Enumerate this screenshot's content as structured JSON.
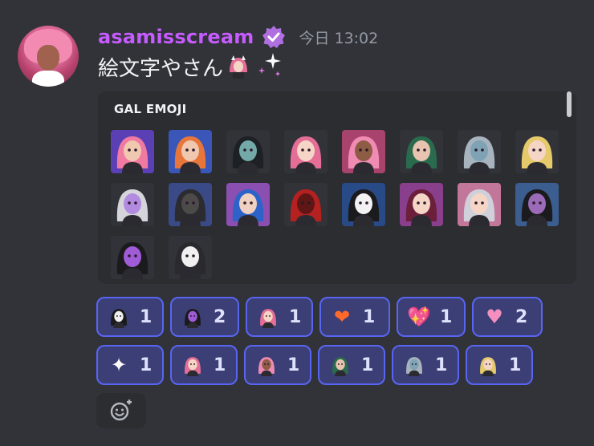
{
  "message": {
    "username": "asamisscream",
    "timestamp": "今日 13:02",
    "text": "絵文字やさん",
    "inline_emojis": [
      "gal-emoji-pink-hair",
      "sparkles-emoji"
    ]
  },
  "embed": {
    "title": "GAL EMOJI",
    "emojis": [
      {
        "name": "pink-hair-purple-bg",
        "bg": "#5b3fb5",
        "hair": "#f17aa3",
        "skin": "#f0c8b0"
      },
      {
        "name": "orange-hair",
        "bg": "#3a56b8",
        "hair": "#e8763a",
        "skin": "#f0c8b0"
      },
      {
        "name": "dark-teal-cat",
        "bg": "#313338",
        "hair": "#1d2024",
        "skin": "#73a9a6"
      },
      {
        "name": "pink-hair-bunny",
        "bg": "#313338",
        "hair": "#e46e96",
        "skin": "#f5d6c6"
      },
      {
        "name": "pink-hair-tan",
        "bg": "#a8436e",
        "hair": "#f08cb4",
        "skin": "#8e5b45"
      },
      {
        "name": "green-hair-crown",
        "bg": "#313338",
        "hair": "#2a6b4e",
        "skin": "#e8c4b0"
      },
      {
        "name": "blue-skin-silver",
        "bg": "#313338",
        "hair": "#a7b3bd",
        "skin": "#7fa2b5"
      },
      {
        "name": "blonde-long",
        "bg": "#313338",
        "hair": "#e5c96a",
        "skin": "#f5d6c6"
      },
      {
        "name": "silver-purple-mask",
        "bg": "#313338",
        "hair": "#d5d4da",
        "skin": "#b28be0"
      },
      {
        "name": "dark-hood",
        "bg": "#3a4a86",
        "hair": "#2b2b30",
        "skin": "#4d4a4a"
      },
      {
        "name": "blue-hair-mic",
        "bg": "#8a4fb0",
        "hair": "#2d62c8",
        "skin": "#f0d0c0"
      },
      {
        "name": "red-hood",
        "bg": "#313338",
        "hair": "#b52121",
        "skin": "#611616"
      },
      {
        "name": "panda-girl",
        "bg": "#284a86",
        "hair": "#1b1b1d",
        "skin": "#f2f2f2"
      },
      {
        "name": "maroon-hair",
        "bg": "#8a3f8d",
        "hair": "#6b1f3a",
        "skin": "#f5d6c6"
      },
      {
        "name": "silver-bunny",
        "bg": "#c2779a",
        "hair": "#cfd0da",
        "skin": "#f5d6c6"
      },
      {
        "name": "dark-cat-purple",
        "bg": "#3c5d8f",
        "hair": "#1b1b1d",
        "skin": "#9b6bb8"
      },
      {
        "name": "dark-cat-purple-2",
        "bg": "#313338",
        "hair": "#1b1b1d",
        "skin": "#a05bd6"
      },
      {
        "name": "white-skull-girl",
        "bg": "#313338",
        "hair": "#2a2a2e",
        "skin": "#f0f0f0"
      }
    ]
  },
  "reactions": [
    {
      "emoji": "panda-girl",
      "count": "1",
      "kind": "img",
      "color": "#f0f0f0",
      "hair": "#1b1b1d"
    },
    {
      "emoji": "dark-cat-purple",
      "count": "2",
      "kind": "img",
      "color": "#a05bd6",
      "hair": "#1b1b1d"
    },
    {
      "emoji": "pink-hair-glasses",
      "count": "1",
      "kind": "img",
      "color": "#f5d6c6",
      "hair": "#e46e96"
    },
    {
      "emoji": "heart-on-fire",
      "count": "1",
      "kind": "glyph",
      "glyph": "❤",
      "color": "#ff6a2b"
    },
    {
      "emoji": "sparkling-heart",
      "count": "1",
      "kind": "glyph",
      "glyph": "💖",
      "color": "#f25aa6"
    },
    {
      "emoji": "pixel-hearts",
      "count": "2",
      "kind": "glyph",
      "glyph": "♥",
      "color": "#f48fbf"
    },
    {
      "emoji": "sparkles",
      "count": "1",
      "kind": "glyph",
      "glyph": "✦",
      "color": "#ffffff"
    },
    {
      "emoji": "pink-hair-bunny",
      "count": "1",
      "kind": "img",
      "color": "#f5d6c6",
      "hair": "#e46e96"
    },
    {
      "emoji": "pink-hair-tan",
      "count": "1",
      "kind": "img",
      "color": "#8e5b45",
      "hair": "#f08cb4"
    },
    {
      "emoji": "green-hair-crown",
      "count": "1",
      "kind": "img",
      "color": "#e8c4b0",
      "hair": "#2a6b4e"
    },
    {
      "emoji": "blue-skin-silver",
      "count": "1",
      "kind": "img",
      "color": "#7fa2b5",
      "hair": "#a7b3bd"
    },
    {
      "emoji": "blonde-long",
      "count": "1",
      "kind": "img",
      "color": "#f5d6c6",
      "hair": "#e5c96a"
    }
  ],
  "colors": {
    "username": "#c65bff",
    "reaction_border": "#5865f2",
    "reaction_bg": "#3b3f75",
    "background": "#313338",
    "embed_bg": "#2b2d31"
  },
  "icons": {
    "verified": "verified-badge-icon",
    "add_reaction": "add-reaction-smiley-icon"
  }
}
